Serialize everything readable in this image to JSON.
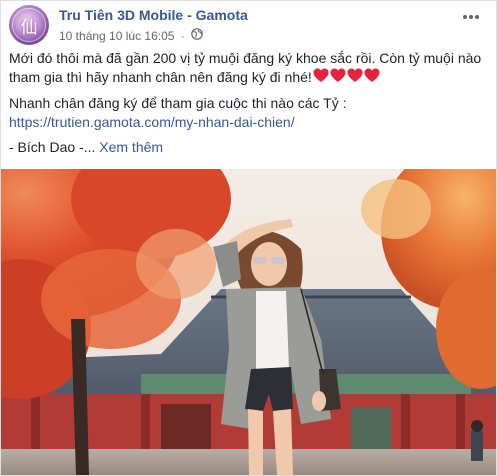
{
  "post": {
    "page_name": "Tru Tiên 3D Mobile - Gamota",
    "timestamp": "10 tháng 10 lúc 16:05",
    "separator": "·",
    "privacy_icon": "globe-icon",
    "more_icon": "more-horizontal-icon",
    "paragraph_1": "Mới đó thôi mà đã gần 200 vị tỷ muội đăng ký khoe sắc rồi. Còn tỷ muội nào tham gia thì hãy nhanh chân nên đăng ký đi nhé!",
    "hearts_count": 4,
    "heart_color": "#e6223d",
    "paragraph_2_line1": "Nhanh chân đăng ký để tham gia cuộc thi nào các Tỷ :",
    "link_text": "https://trutien.gamota.com/my-nhan-dai-chien/",
    "signature": "- Bích Dao -...",
    "see_more": "Xem thêm"
  },
  "colors": {
    "page_name": "#365899",
    "link": "#385898",
    "meta": "#616770",
    "border": "#dddfe2"
  }
}
